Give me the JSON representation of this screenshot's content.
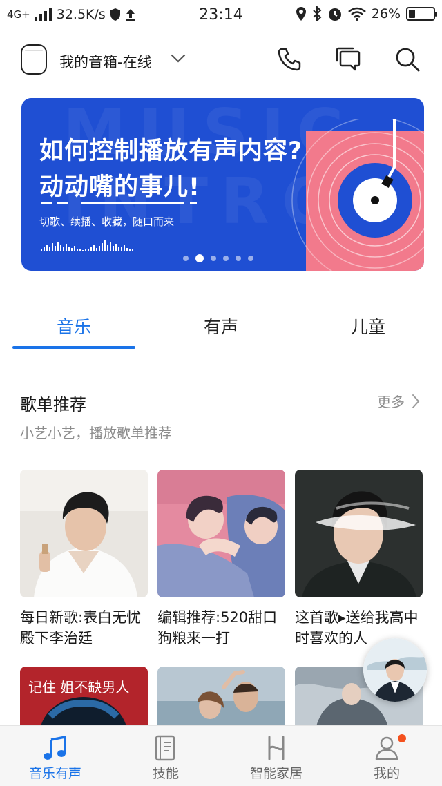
{
  "status_bar": {
    "network": "4G+",
    "speed": "32.5K/s",
    "time": "23:14",
    "battery": "26%",
    "battery_level": 0.26
  },
  "header": {
    "device_name": "我的音箱-在线",
    "icons": [
      "speaker-icon",
      "chevron-down-icon",
      "phone-icon",
      "message-icon",
      "search-icon"
    ]
  },
  "banner": {
    "line1": "如何控制播放有声内容?",
    "line2": "动动嘴的事儿!",
    "subtitle": "切歌、续播、收藏，随口而来",
    "page_count": 6,
    "active_page": 2
  },
  "tabs": [
    {
      "label": "音乐",
      "active": true
    },
    {
      "label": "有声",
      "active": false
    },
    {
      "label": "儿童",
      "active": false
    }
  ],
  "section": {
    "title": "歌单推荐",
    "more": "更多",
    "subtitle": "小艺小艺，播放歌单推荐"
  },
  "playlists": [
    {
      "title": "每日新歌:表白无忧殿下李治廷"
    },
    {
      "title": "编辑推荐:520甜口狗粮来一打"
    },
    {
      "title": "这首歌▸送给我高中时喜欢的人"
    }
  ],
  "playlists_row2": [
    {
      "cover_text": "记住 姐不缺男人"
    }
  ],
  "bottom_nav": [
    {
      "label": "音乐有声",
      "icon": "music-note-icon",
      "active": true
    },
    {
      "label": "技能",
      "icon": "book-icon",
      "active": false
    },
    {
      "label": "智能家居",
      "icon": "smart-home-icon",
      "active": false
    },
    {
      "label": "我的",
      "icon": "user-icon",
      "active": false,
      "badge": true
    }
  ],
  "colors": {
    "accent": "#1a73e8",
    "banner_blue": "#1f4fd3",
    "banner_pink": "#f27a8c",
    "badge_red": "#f4511e"
  }
}
